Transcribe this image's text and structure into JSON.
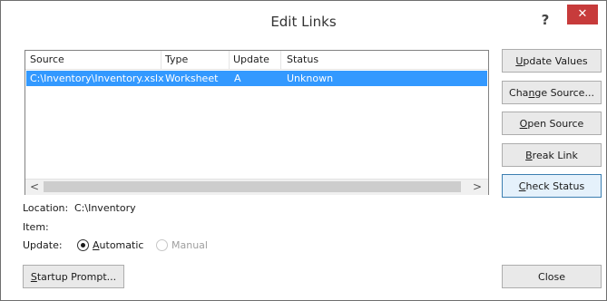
{
  "dialog": {
    "title": "Edit Links",
    "help": "?",
    "close": "✕"
  },
  "list": {
    "columns": [
      "Source",
      "Type",
      "Update",
      "Status"
    ],
    "rows": [
      {
        "source": "C:\\Inventory\\Inventory.xslx",
        "type": "Worksheet",
        "update": "A",
        "status": "Unknown",
        "selected": true
      }
    ],
    "scroll_left": "<",
    "scroll_right": ">"
  },
  "buttons": {
    "update_values": {
      "pre": "",
      "key": "U",
      "post": "pdate Values"
    },
    "change_source": {
      "pre": "Cha",
      "key": "n",
      "post": "ge Source..."
    },
    "open_source": {
      "pre": "",
      "key": "O",
      "post": "pen Source"
    },
    "break_link": {
      "pre": "",
      "key": "B",
      "post": "reak Link"
    },
    "check_status": {
      "pre": "",
      "key": "C",
      "post": "heck Status"
    },
    "startup_prompt": {
      "pre": "",
      "key": "S",
      "post": "tartup Prompt..."
    },
    "close": "Close"
  },
  "details": {
    "location_label": "Location:",
    "location_value": "C:\\Inventory",
    "item_label": "Item:",
    "update_label": "Update:",
    "automatic": {
      "pre": "",
      "key": "A",
      "post": "utomatic"
    },
    "manual": "Manual"
  }
}
